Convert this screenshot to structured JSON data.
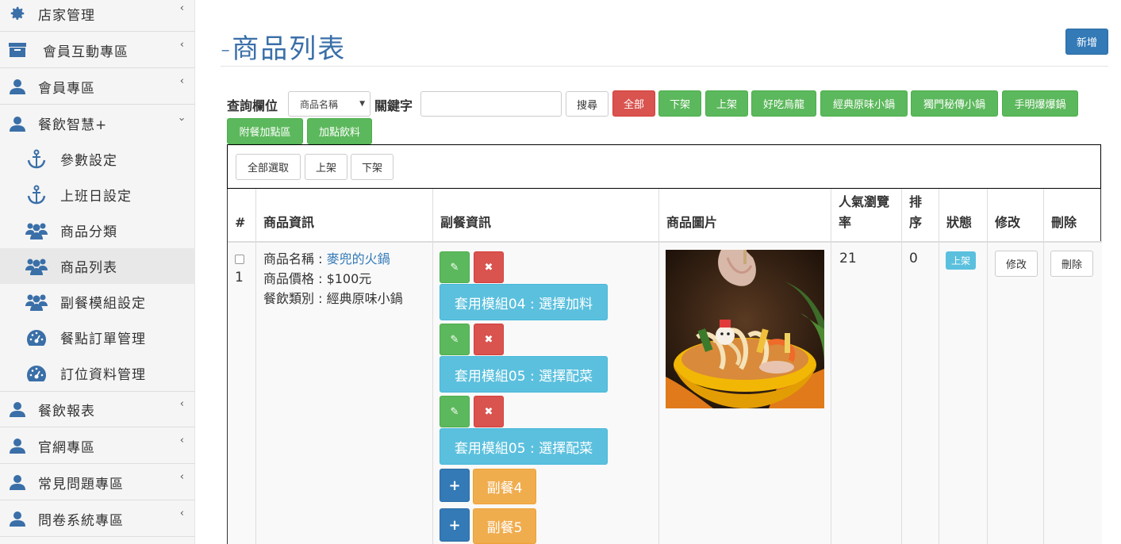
{
  "sidebar": {
    "items": [
      {
        "label": "店家管理",
        "icon": "gear-icon",
        "has_chevron": true
      },
      {
        "label": "會員互動專區",
        "icon": "archive-icon",
        "has_chevron": true
      },
      {
        "label": "會員專區",
        "icon": "user-icon",
        "has_chevron": true
      },
      {
        "label": "餐飲智慧+",
        "icon": "user-icon",
        "expanded": true
      },
      {
        "label": "餐飲報表",
        "icon": "user-icon",
        "has_chevron": true
      },
      {
        "label": "官網專區",
        "icon": "user-icon",
        "has_chevron": true
      },
      {
        "label": "常見問題專區",
        "icon": "user-icon",
        "has_chevron": true
      },
      {
        "label": "問卷系統專區",
        "icon": "user-icon",
        "has_chevron": true
      }
    ],
    "subitems": [
      {
        "label": "參數設定",
        "icon": "anchor-icon"
      },
      {
        "label": "上班日設定",
        "icon": "anchor-icon"
      },
      {
        "label": "商品分類",
        "icon": "users-icon"
      },
      {
        "label": "商品列表",
        "icon": "users-icon",
        "active": true
      },
      {
        "label": "副餐模組設定",
        "icon": "users-icon"
      },
      {
        "label": "餐點訂單管理",
        "icon": "dashboard-icon"
      },
      {
        "label": "訂位資料管理",
        "icon": "dashboard-icon"
      }
    ]
  },
  "page": {
    "title": "-商品列表",
    "add_button": "新增"
  },
  "search": {
    "field_label": "查詢欄位",
    "field_select": "商品名稱",
    "keyword_label": "關鍵字",
    "keyword_value": "",
    "search_button": "搜尋",
    "filters": [
      "全部",
      "下架",
      "上架",
      "好吃烏龍",
      "經典原味小鍋",
      "獨門秘傳小鍋",
      "手明爆爆鍋",
      "附餐加點區",
      "加點飲料"
    ]
  },
  "bulk": {
    "select_all": "全部選取",
    "on_shelf": "上架",
    "off_shelf": "下架"
  },
  "table": {
    "headers": [
      "#",
      "商品資訊",
      "副餐資訊",
      "商品圖片",
      "人氣瀏覽率",
      "排序",
      "狀態",
      "修改",
      "刪除"
    ],
    "rows": [
      {
        "index": "1",
        "name_label": "商品名稱 : ",
        "name": "麥兜的火鍋",
        "price": "商品價格 : $100元",
        "category": "餐飲類別 : 經典原味小鍋",
        "modules": [
          "套用模組04 : 選擇加料",
          "套用模組05 : 選擇配菜",
          "套用模組05 : 選擇配菜"
        ],
        "side_dishes": [
          "副餐4",
          "副餐5"
        ],
        "views": "21",
        "order": "0",
        "status": "上架",
        "edit": "修改",
        "delete": "刪除"
      }
    ]
  },
  "colors": {
    "primary": "#337ab7",
    "success": "#5cb85c",
    "danger": "#d9534f",
    "info": "#5bc0de",
    "warning": "#f0ad4e"
  }
}
